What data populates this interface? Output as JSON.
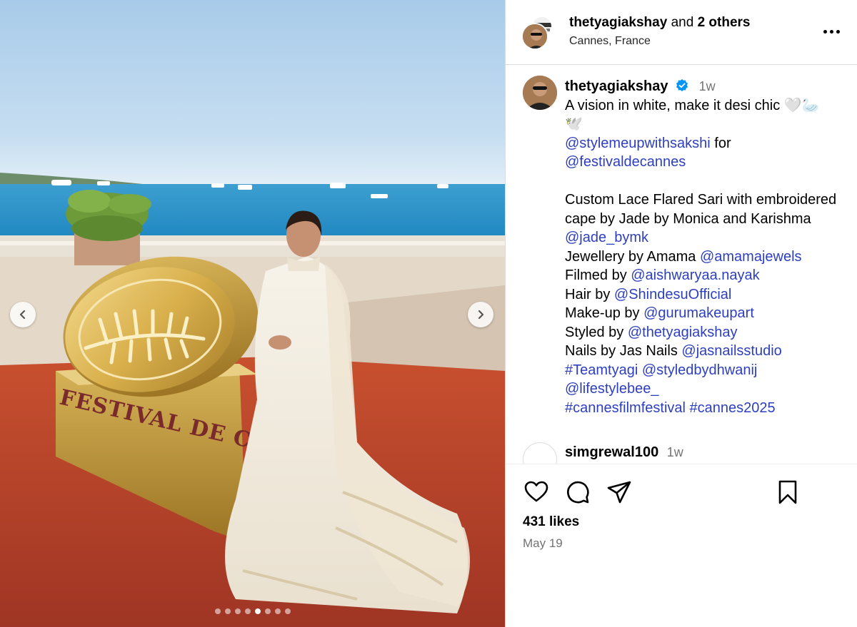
{
  "post_header": {
    "owner": "thetyagiakshay",
    "joiner": "and",
    "others": "2 others",
    "location": "Cannes, France"
  },
  "caption": {
    "username": "thetyagiakshay",
    "time": "1w",
    "line1": "A vision in white, make it desi chic 🤍🦢",
    "line1b": "🕊️",
    "mention_stylist": "@stylemeupwithsakshi",
    "for_word": " for",
    "mention_festival": "@festivaldecannes",
    "outfit_1": "Custom Lace Flared Sari with embroidered",
    "outfit_2": "cape by Jade by Monica and Karishma",
    "mention_jade": "@jade_bymk",
    "jewellery_label": "Jewellery by Amama ",
    "mention_jewellery": "@amamajewels",
    "filmed_label": "Filmed by ",
    "mention_filmed": "@aishwaryaa.nayak",
    "hair_label": "Hair by ",
    "mention_hair": "@ShindesuOfficial",
    "makeup_label": "Make-up by ",
    "mention_makeup": "@gurumakeupart",
    "styled_label": "Styled by ",
    "mention_styled": "@thetyagiakshay",
    "nails_label": "Nails by Jas Nails ",
    "mention_nails": "@jasnailsstudio",
    "tag_team": "#Teamtyagi",
    "mention_dhwanij": "@styledbydhwanij",
    "mention_lifestyle": "@lifestylebee_",
    "tag_festival": "#cannesfilmfestival",
    "tag_year": "#cannes2025"
  },
  "comment2": {
    "username": "simgrewal100",
    "time": "1w"
  },
  "stats": {
    "likes": "431 likes",
    "date": "May 19"
  },
  "carousel": {
    "sign_text": "FESTIVAL DE CANNES",
    "slide_count": 8,
    "active_slide": 4
  },
  "icons": {
    "like": "heart-icon",
    "comment": "comment-icon",
    "share": "share-icon",
    "save": "bookmark-icon",
    "verified": "verified-badge-icon",
    "more": "more-options-icon"
  },
  "colors": {
    "link": "#2d3fbf",
    "verified": "#0095f6",
    "muted": "#737373",
    "divider": "#dbdbdb",
    "carpet": "#b8422c",
    "sea": "#2c8fc4"
  }
}
